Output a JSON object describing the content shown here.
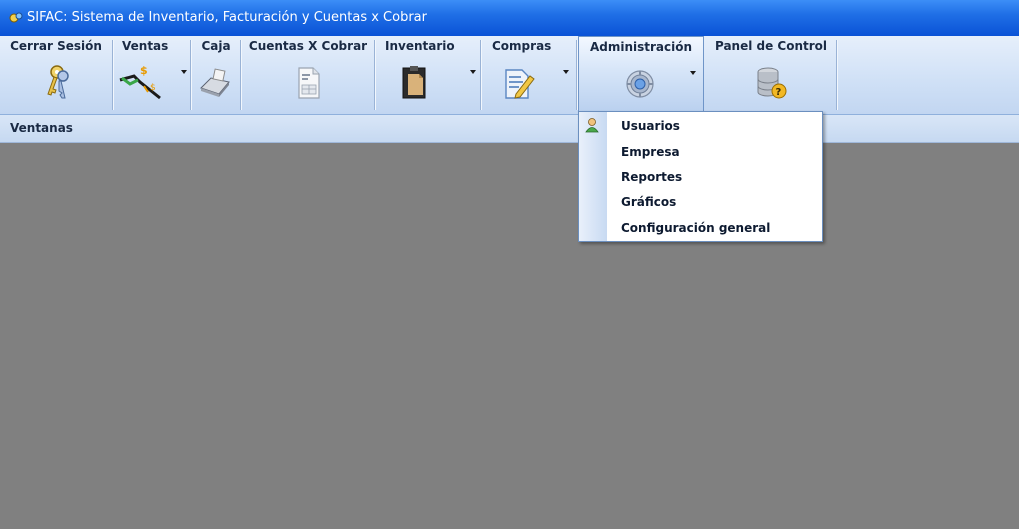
{
  "window": {
    "title": "SIFAC: Sistema de Inventario, Facturación y Cuentas x Cobrar"
  },
  "ribbon": {
    "buttons": [
      {
        "label": "Cerrar Sesión",
        "icon": "keys-icon",
        "dropdown": false
      },
      {
        "label": "Ventas",
        "icon": "cash-register-pen-icon",
        "dropdown": true
      },
      {
        "label": "Caja",
        "icon": "cash-machine-icon",
        "dropdown": false
      },
      {
        "label": "Cuentas X Cobrar",
        "icon": "document-icon",
        "dropdown": false
      },
      {
        "label": "Inventario",
        "icon": "clipboard-icon",
        "dropdown": true
      },
      {
        "label": "Compras",
        "icon": "edit-document-icon",
        "dropdown": true
      },
      {
        "label": "Administración",
        "icon": "gear-icon",
        "dropdown": true,
        "active": true
      },
      {
        "label": "Panel de Control",
        "icon": "database-help-icon",
        "dropdown": false
      }
    ]
  },
  "windows_bar": {
    "label": "Ventanas"
  },
  "admin_menu": {
    "items": [
      {
        "label": "Usuarios",
        "icon": "user-icon"
      },
      {
        "label": "Empresa",
        "icon": ""
      },
      {
        "label": "Reportes",
        "icon": ""
      },
      {
        "label": "Gráficos",
        "icon": ""
      },
      {
        "label": "Configuración general",
        "icon": ""
      }
    ]
  },
  "colors": {
    "titlebar": "#1f6fe6",
    "ribbon": "#cfe0f6",
    "workspace": "#808080"
  }
}
